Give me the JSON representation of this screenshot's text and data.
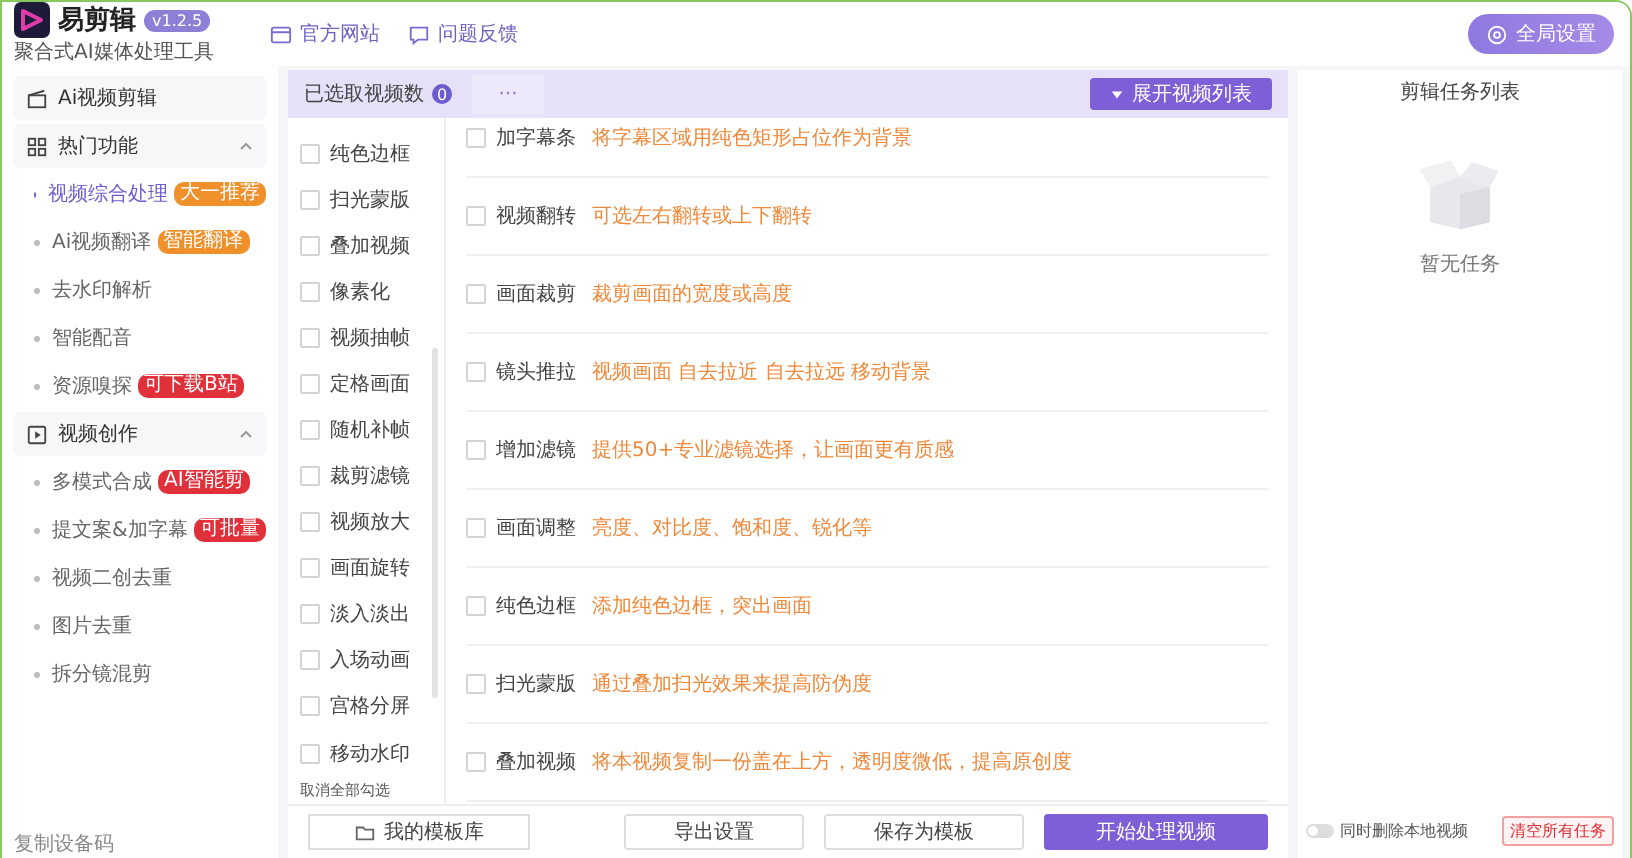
{
  "app": {
    "name": "易剪辑",
    "version": "v1.2.5",
    "subtitle": "聚合式AI媒体处理工具"
  },
  "top_links": [
    {
      "label": "官方网站"
    },
    {
      "label": "问题反馈"
    }
  ],
  "settings_button": "全局设置",
  "sidebar": {
    "items": [
      {
        "label": "Ai视频剪辑",
        "kind": "link"
      },
      {
        "label": "热门功能",
        "kind": "group",
        "expanded": true,
        "children": [
          {
            "label": "视频综合处理",
            "selected": true,
            "badge": {
              "text": "大一推荐",
              "color": "#f0902a"
            }
          },
          {
            "label": "Ai视频翻译",
            "selected": false,
            "badge": {
              "text": "智能翻译",
              "color": "#f0902a"
            }
          },
          {
            "label": "去水印解析",
            "selected": false
          },
          {
            "label": "智能配音",
            "selected": false
          },
          {
            "label": "资源嗅探",
            "selected": false,
            "badge": {
              "text": "可下载B站",
              "color": "#e0303a"
            }
          }
        ]
      },
      {
        "label": "视频创作",
        "kind": "group",
        "expanded": true,
        "children": [
          {
            "label": "多模式合成",
            "selected": false,
            "badge": {
              "text": "AI智能剪",
              "color": "#e0303a"
            }
          },
          {
            "label": "提文案&加字幕",
            "selected": false,
            "badge": {
              "text": "可批量",
              "color": "#e0303a"
            }
          },
          {
            "label": "视频二创去重",
            "selected": false
          },
          {
            "label": "图片去重",
            "selected": false
          },
          {
            "label": "拆分镜混剪",
            "selected": false
          }
        ]
      }
    ],
    "footer": "复制设备码"
  },
  "main": {
    "selected_count_label": "已选取视频数",
    "selected_count": "0",
    "more": "···",
    "expand_button": "展开视频列表",
    "options": [
      {
        "label": "纯色边框",
        "checked": false
      },
      {
        "label": "扫光蒙版",
        "checked": false
      },
      {
        "label": "叠加视频",
        "checked": false
      },
      {
        "label": "像素化",
        "checked": false
      },
      {
        "label": "视频抽帧",
        "checked": false
      },
      {
        "label": "定格画面",
        "checked": false
      },
      {
        "label": "随机补帧",
        "checked": false
      },
      {
        "label": "裁剪滤镜",
        "checked": false
      },
      {
        "label": "视频放大",
        "checked": false
      },
      {
        "label": "画面旋转",
        "checked": false
      },
      {
        "label": "淡入淡出",
        "checked": false
      },
      {
        "label": "入场动画",
        "checked": false
      },
      {
        "label": "宫格分屏",
        "checked": false
      },
      {
        "label": "移动水印",
        "checked": false
      }
    ],
    "clear_all": "取消全部勾选",
    "effects": [
      {
        "label": "加字幕条",
        "description": "将字幕区域用纯色矩形占位作为背景",
        "checked": false
      },
      {
        "label": "视频翻转",
        "description": "可选左右翻转或上下翻转",
        "checked": false
      },
      {
        "label": "画面裁剪",
        "description": "裁剪画面的宽度或高度",
        "checked": false
      },
      {
        "label": "镜头推拉",
        "description": "视频画面 自去拉近 自去拉远 移动背景",
        "checked": false
      },
      {
        "label": "增加滤镜",
        "description": "提供50+专业滤镜选择，让画面更有质感",
        "checked": false
      },
      {
        "label": "画面调整",
        "description": "亮度、对比度、饱和度、锐化等",
        "checked": false
      },
      {
        "label": "纯色边框",
        "description": "添加纯色边框，突出画面",
        "checked": false
      },
      {
        "label": "扫光蒙版",
        "description": "通过叠加扫光效果来提高防伪度",
        "checked": false
      },
      {
        "label": "叠加视频",
        "description": "将本视频复制一份盖在上方，透明度微低，提高原创度",
        "checked": false
      }
    ],
    "template_button": "我的模板库",
    "buttons": [
      {
        "label": "导出设置",
        "kind": "secondary"
      },
      {
        "label": "保存为模板",
        "kind": "secondary"
      },
      {
        "label": "开始处理视频",
        "kind": "primary"
      }
    ]
  },
  "tasks": {
    "title": "剪辑任务列表",
    "empty_text": "暂无任务",
    "delete_local": {
      "label": "同时删除本地视频",
      "on": false
    },
    "clear_button": "清空所有任务"
  }
}
